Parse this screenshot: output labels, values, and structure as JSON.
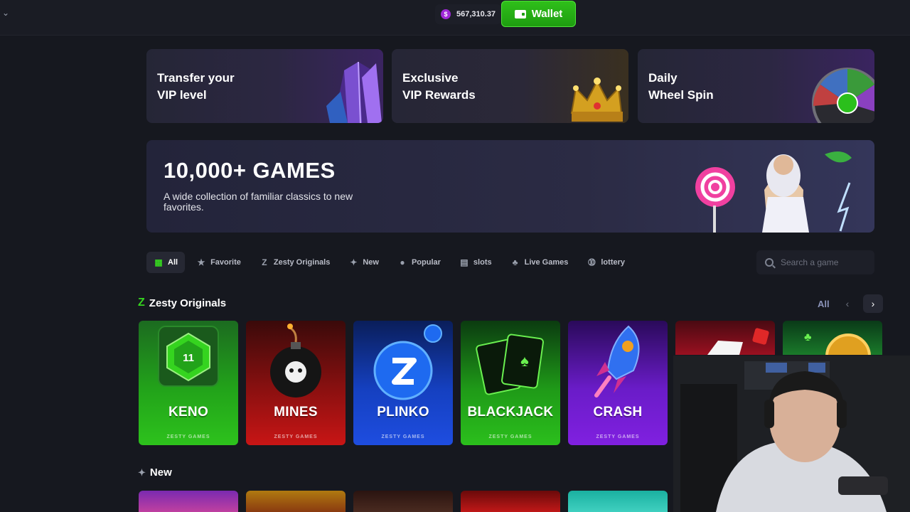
{
  "header": {
    "balance": "567,310.37",
    "currency_symbol": "$",
    "wallet_label": "Wallet"
  },
  "promos": [
    {
      "line1": "Transfer your",
      "line2": "VIP level"
    },
    {
      "line1": "Exclusive",
      "line2": "VIP Rewards"
    },
    {
      "line1": "Daily",
      "line2": "Wheel Spin"
    }
  ],
  "hero": {
    "title": "10,000+ GAMES",
    "subtitle": "A wide collection of familiar classics to new favorites."
  },
  "tabs": [
    {
      "label": "All",
      "icon": "grid-icon",
      "active": true
    },
    {
      "label": "Favorite",
      "icon": "star-icon"
    },
    {
      "label": "Zesty Originals",
      "icon": "zesty-logo-icon"
    },
    {
      "label": "New",
      "icon": "sparkle-star-icon"
    },
    {
      "label": "Popular",
      "icon": "flame-icon"
    },
    {
      "label": "slots",
      "icon": "slot-machine-icon"
    },
    {
      "label": "Live Games",
      "icon": "cards-icon"
    },
    {
      "label": "lottery",
      "icon": "lottery-ball-icon"
    }
  ],
  "search": {
    "placeholder": "Search a game"
  },
  "originals": {
    "title": "Zesty Originals",
    "all_label": "All",
    "games": [
      {
        "name": "KENO",
        "studio": "ZESTY GAMES",
        "badge": "11"
      },
      {
        "name": "MINES",
        "studio": "ZESTY GAMES"
      },
      {
        "name": "PLINKO",
        "studio": "ZESTY GAMES"
      },
      {
        "name": "BLACKJACK",
        "studio": "ZESTY GAMES"
      },
      {
        "name": "CRASH",
        "studio": "ZESTY GAMES"
      }
    ]
  },
  "new_section": {
    "title": "New"
  },
  "colors": {
    "accent": "#35d41f",
    "background": "#16181f",
    "card": "#262833"
  }
}
